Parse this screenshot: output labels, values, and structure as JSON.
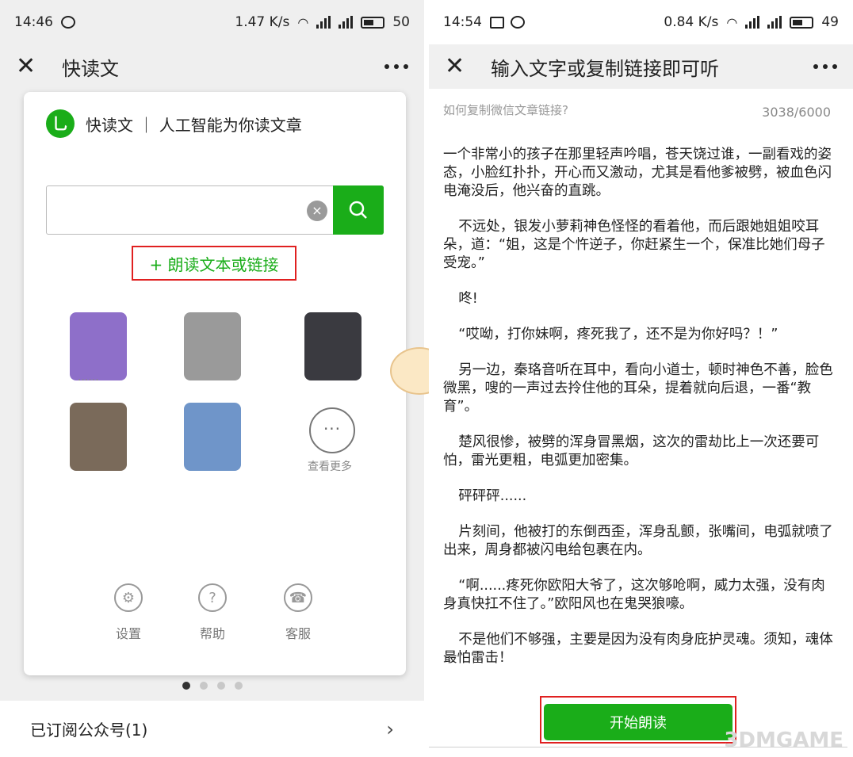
{
  "left": {
    "status": {
      "time": "14:46",
      "speed": "1.47 K/s",
      "battery": "50"
    },
    "title": "快读文",
    "brand": {
      "logo_glyph": "乚",
      "text": "快读文 ｜ 人工智能为你读文章"
    },
    "search": {
      "value": "",
      "clear_icon": "clear-icon",
      "submit_icon": "search-icon"
    },
    "add_link_label": "+ 朗读文本或链接",
    "avatars": [
      {
        "color": "#8e6fc9",
        "label": "......"
      },
      {
        "color": "#9a9a9a",
        "label": ""
      },
      {
        "color": "#3a3a40",
        "label": ""
      },
      {
        "color": "#7a6a5a",
        "label": ""
      },
      {
        "color": "#6f95c9",
        "label": ""
      }
    ],
    "more_label": "查看更多",
    "tools": [
      {
        "label": "设置",
        "icon": "settings-icon",
        "glyph": "⚙"
      },
      {
        "label": "帮助",
        "icon": "help-icon",
        "glyph": "?"
      },
      {
        "label": "客服",
        "icon": "headset-icon",
        "glyph": "☎"
      }
    ],
    "page_dots": {
      "count": 4,
      "active": 0
    },
    "subscriptions_label": "已订阅公众号(1)"
  },
  "right": {
    "status": {
      "time": "14:54",
      "speed": "0.84 K/s",
      "battery": "49"
    },
    "title": "输入文字或复制链接即可听",
    "hint": "如何复制微信文章链接?",
    "counter": "3038/6000",
    "paragraphs": [
      "一个非常小的孩子在那里轻声吟唱，苍天饶过谁，一副看戏的姿态，小脸红扑扑，开心而又激动，尤其是看他爹被劈，被血色闪电淹没后，他兴奋的直跳。",
      "不远处，银发小萝莉神色怪怪的看着他，而后跟她姐姐咬耳朵，道：“姐，这是个忤逆子，你赶紧生一个，保准比她们母子受宠。”",
      "咚!",
      "“哎呦，打你妹啊，疼死我了，还不是为你好吗？！”",
      "另一边，秦珞音听在耳中，看向小道士，顿时神色不善，脸色微黑，嗖的一声过去拎住他的耳朵，提着就向后退，一番“教育”。",
      "楚风很惨，被劈的浑身冒黑烟，这次的雷劫比上一次还要可怕，雷光更粗，电弧更加密集。",
      "砰砰砰......",
      "片刻间，他被打的东倒西歪，浑身乱颤，张嘴间，电弧就喷了出来，周身都被闪电给包裹在内。",
      "“啊......疼死你欧阳大爷了，这次够呛啊，威力太强，没有肉身真快扛不住了。”欧阳风也在鬼哭狼嚎。",
      "不是他们不够强，主要是因为没有肉身庇护灵魂。须知，魂体最怕雷击！"
    ],
    "start_label": "开始朗读"
  },
  "watermark": "3DMGAME",
  "colors": {
    "accent": "#1aad19",
    "highlight": "#e02020"
  }
}
